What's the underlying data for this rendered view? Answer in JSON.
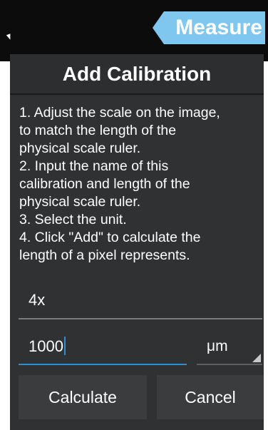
{
  "header": {
    "tab_label": "Measure"
  },
  "dialog": {
    "title": "Add Calibration",
    "instructions": [
      "1. Adjust the scale on the image,",
      "to match the length of the",
      "physical scale ruler.",
      " 2. Input the name of this",
      "calibration and length of the",
      "physical scale ruler.",
      " 3. Select the unit.",
      " 4. Click \"Add\" to calculate the",
      "length of a pixel represents."
    ],
    "name_field": {
      "value": "4x"
    },
    "length_field": {
      "value": "1000"
    },
    "unit_select": {
      "selected": "μm"
    },
    "buttons": {
      "calculate": "Calculate",
      "cancel": "Cancel"
    }
  },
  "colors": {
    "accent_tab": "#7fc7ef",
    "dialog_bg": "#2f3133",
    "focus_underline": "#2f8fcf"
  }
}
